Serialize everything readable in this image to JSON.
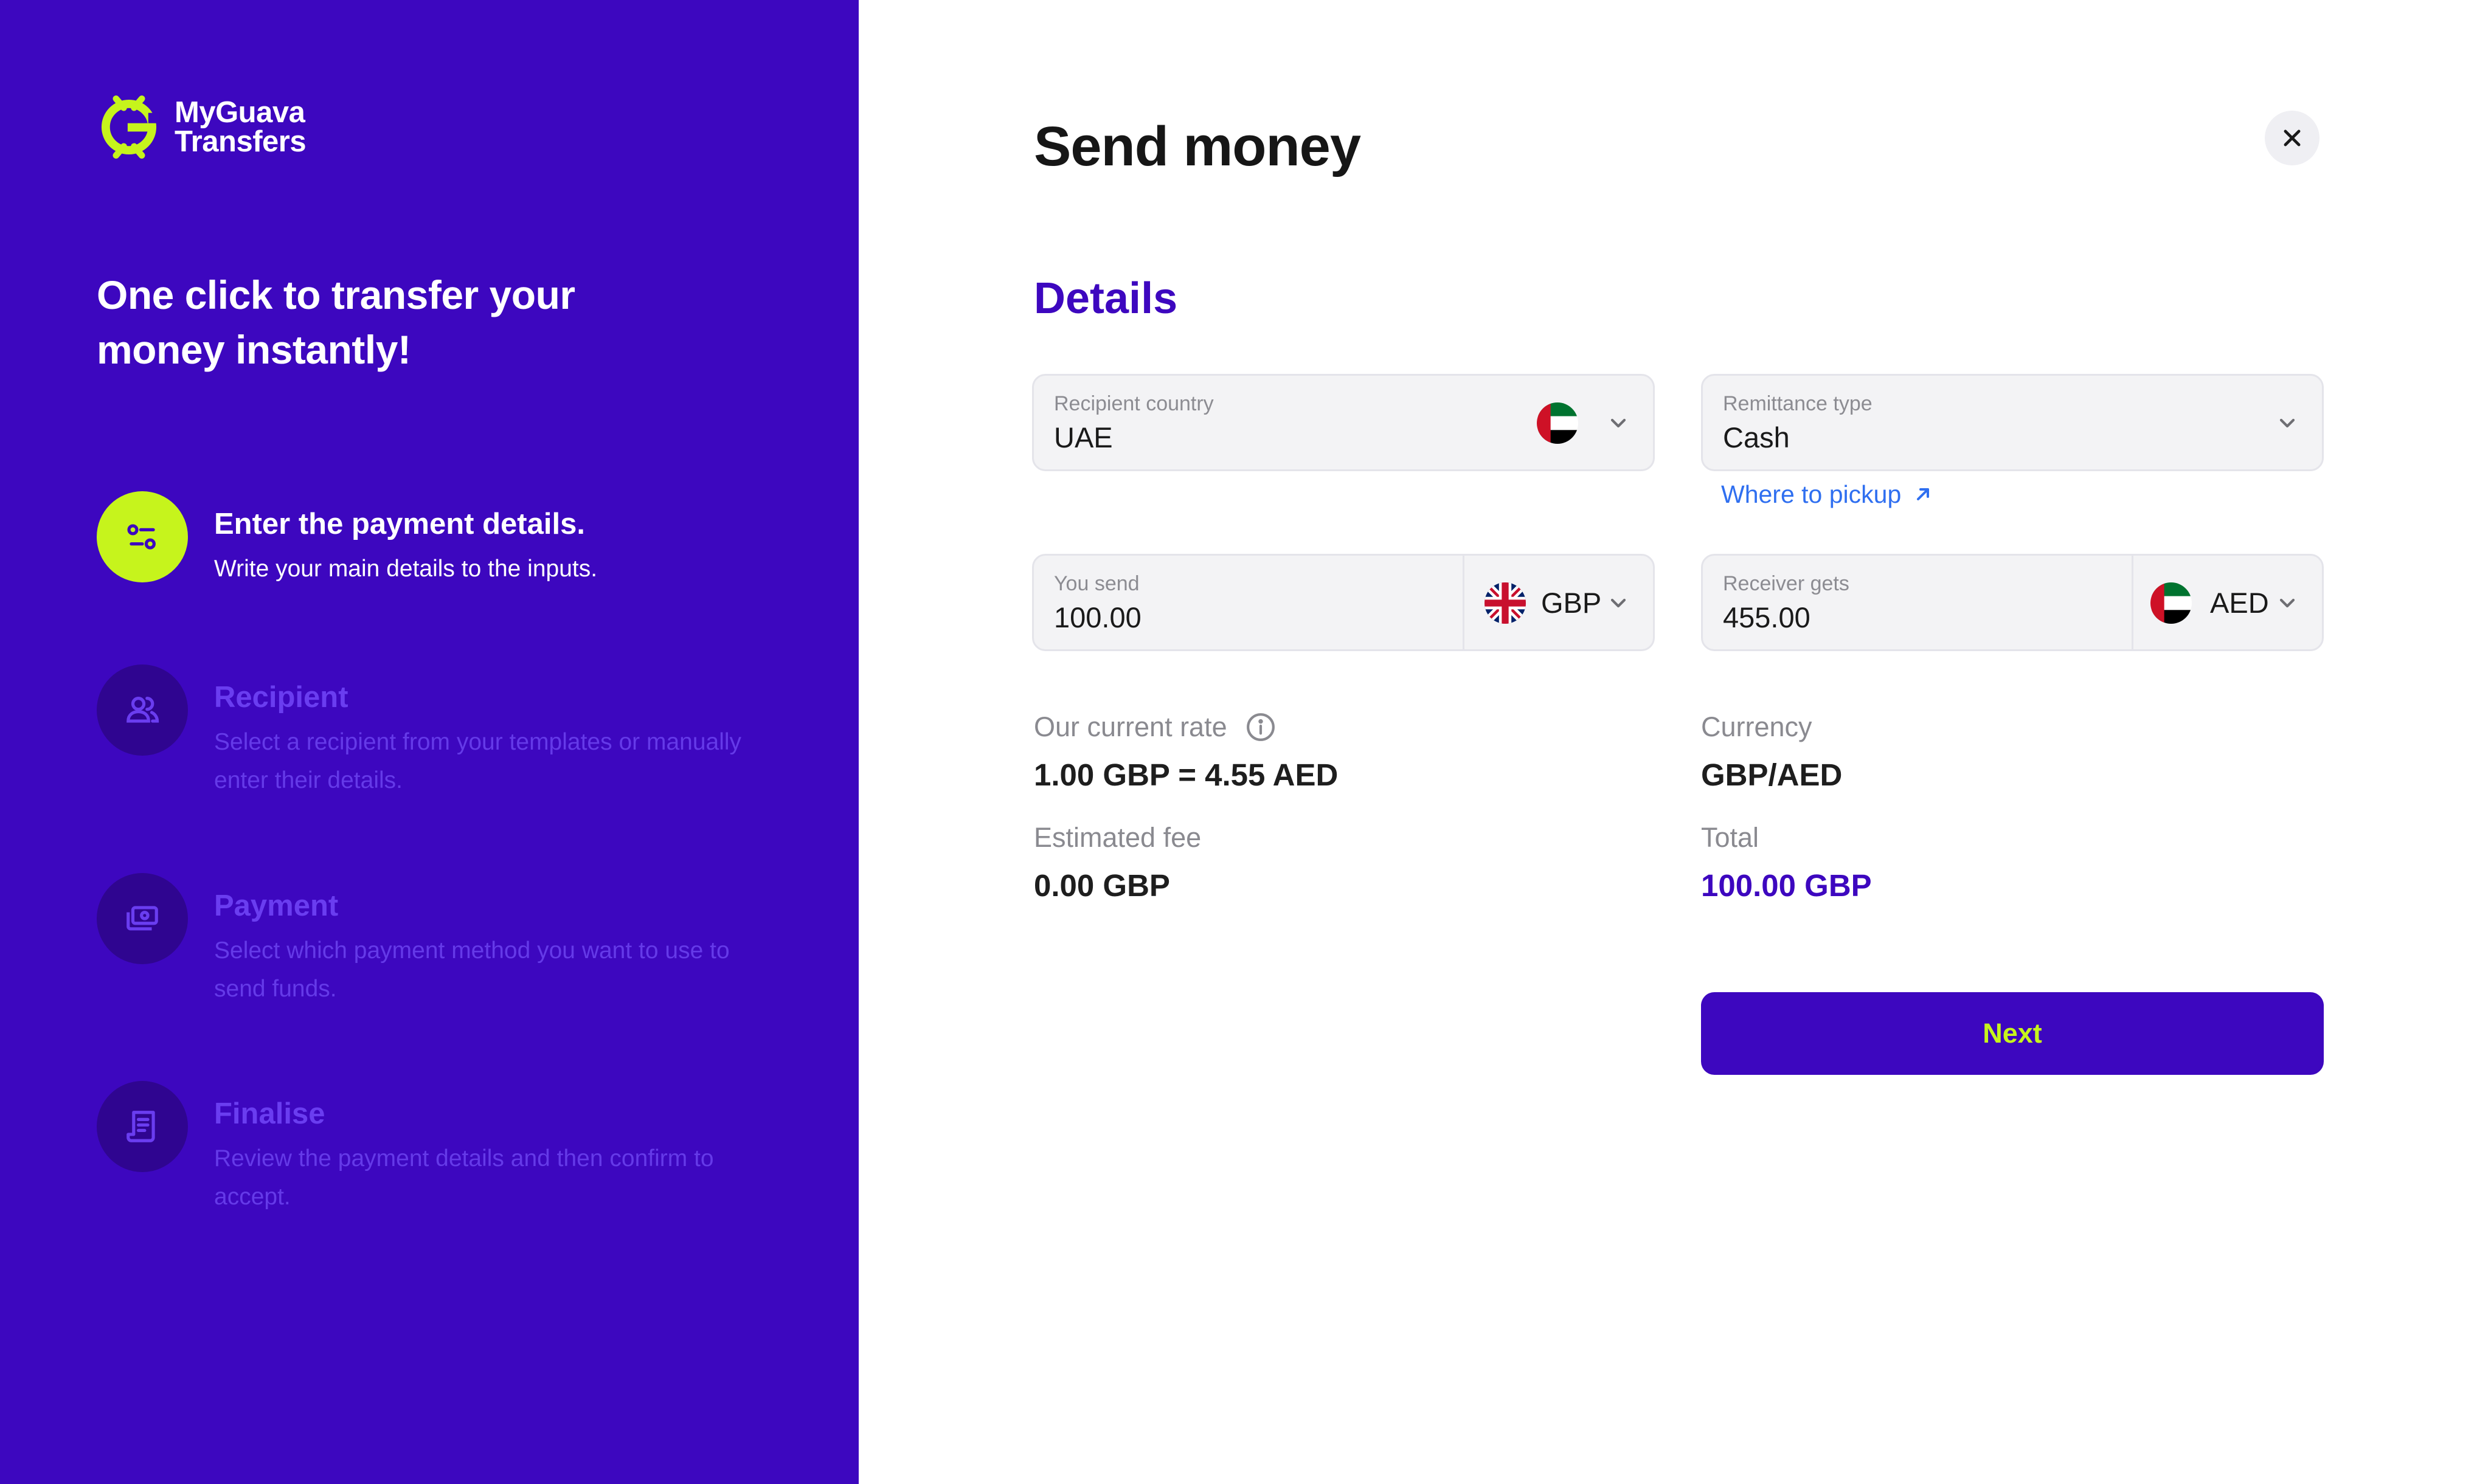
{
  "brand": {
    "line1": "MyGuava",
    "line2": "Transfers"
  },
  "tagline": "One click to transfer your money instantly!",
  "steps": [
    {
      "title": "Enter the payment details.",
      "desc": "Write your main details to the inputs.",
      "state": "active",
      "icon": "sliders-icon"
    },
    {
      "title": "Recipient",
      "desc": "Select a recipient from your templates or manually enter their details.",
      "state": "inactive",
      "icon": "users-icon"
    },
    {
      "title": "Payment",
      "desc": "Select which payment method you want to use to send funds.",
      "state": "inactive",
      "icon": "money-icon"
    },
    {
      "title": "Finalise",
      "desc": "Review the payment details and then confirm to accept.",
      "state": "inactive",
      "icon": "receipt-icon"
    }
  ],
  "page": {
    "title": "Send money",
    "section_title": "Details",
    "close_icon": "close-icon"
  },
  "form": {
    "recipient_country": {
      "label": "Recipient country",
      "value": "UAE",
      "flag": "ae"
    },
    "remittance_type": {
      "label": "Remittance type",
      "value": "Cash"
    },
    "pickup_link": "Where to pickup",
    "you_send": {
      "label": "You send",
      "value": "100.00",
      "currency": "GBP",
      "flag": "gb"
    },
    "receiver_gets": {
      "label": "Receiver gets",
      "value": "455.00",
      "currency": "AED",
      "flag": "ae"
    }
  },
  "summary": {
    "rate_label": "Our current rate",
    "rate_value": "1.00 GBP = 4.55 AED",
    "currency_label": "Currency",
    "currency_value": "GBP/AED",
    "fee_label": "Estimated fee",
    "fee_value": "0.00 GBP",
    "total_label": "Total",
    "total_value": "100.00 GBP"
  },
  "actions": {
    "next_label": "Next"
  },
  "colors": {
    "primary": "#3d07bf",
    "accent": "#c6f41c",
    "link": "#2f6ff0",
    "inactive_circle": "#2f0590"
  }
}
